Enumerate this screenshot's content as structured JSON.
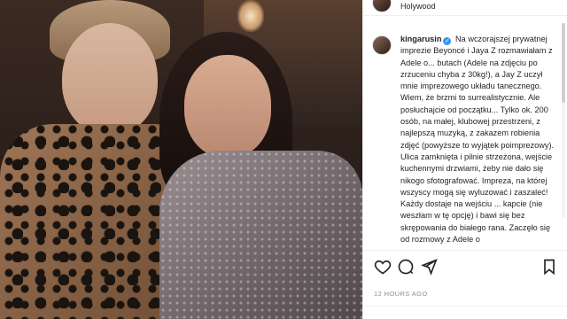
{
  "header": {
    "location": "Holywood"
  },
  "post": {
    "username": "kingarusin",
    "verified": true,
    "caption": "Na wczorajszej prywatnej imprezie Beyoncé i Jaya Z rozmawiałam z Adele o... butach (Adele na zdjęciu po zrzuceniu chyba z 30kg!), a Jay Z uczył mnie imprezowego układu tanecznego. Wiem, że brzmi to surrealistycznie. Ale posłuchajcie od początku... Tylko ok. 200 osób, na małej, klubowej przestrzeni, z najlepszą muzyką, z zakazem robienia zdjęć (powyższe to wyjątek poimprezowy). Ulica zamknięta i pilnie strzeżona, wejście kuchennymi drzwiami, żeby nie dało się nikogo sfotografować. Impreza, na której wszyscy mogą się wyluzować i zaszaleć! Każdy dostaje na wejściu ... kapcie (nie weszłam w tę opcję) i bawi się bez skrępowania do białego rana. Zaczęło się od rozmowy z Adele o",
    "timestamp": "12 HOURS AGO"
  },
  "icons": {
    "like": "heart-icon",
    "comment": "comment-icon",
    "share": "share-icon",
    "save": "bookmark-icon",
    "verified": "verified-badge-icon"
  },
  "colors": {
    "verified": "#3897f0",
    "text": "#262626",
    "muted": "#8e8e8e"
  }
}
